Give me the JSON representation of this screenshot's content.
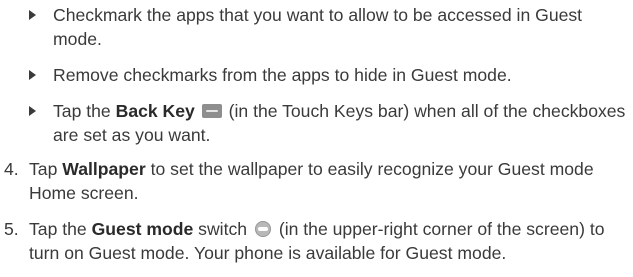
{
  "bullets": [
    {
      "text": "Checkmark the apps that you want to allow to be accessed in Guest mode."
    },
    {
      "text": "Remove checkmarks from the apps to hide in Guest mode."
    },
    {
      "pre": "Tap the ",
      "bold": "Back Key",
      "icon": "back-key-icon",
      "post": " (in the Touch Keys bar) when all of the checkboxes are set as you want."
    }
  ],
  "steps": [
    {
      "number": "4.",
      "pre": "Tap ",
      "bold": "Wallpaper",
      "post": " to set the wallpaper to easily recognize your Guest mode Home screen."
    },
    {
      "number": "5.",
      "pre": "Tap the ",
      "bold": "Guest mode",
      "mid": " switch",
      "icon": "guest-mode-switch-icon",
      "post": " (in the upper-right corner of the screen) to turn on Guest mode. Your phone is available for Guest mode."
    }
  ]
}
